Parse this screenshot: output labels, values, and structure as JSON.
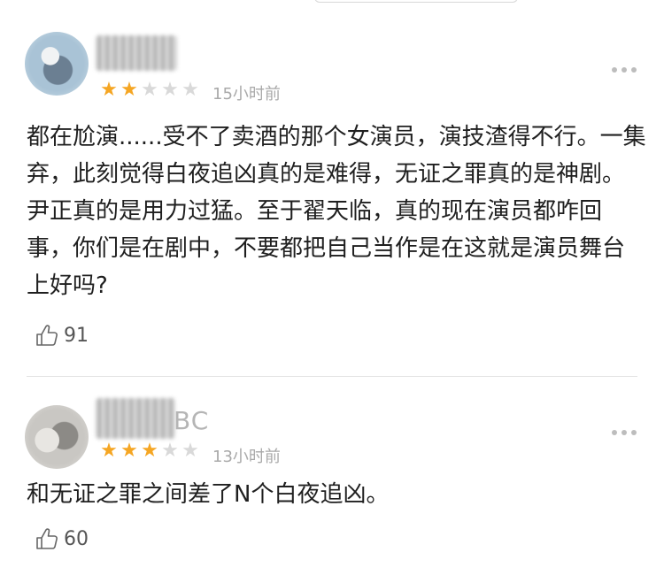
{
  "reviews": [
    {
      "username_suffix": "",
      "rating": 2,
      "max_rating": 5,
      "time": "15小时前",
      "body": "都在尬演......受不了卖酒的那个女演员，演技渣得不行。一集弃，此刻觉得白夜追凶真的是难得，无证之罪真的是神剧。尹正真的是用力过猛。至于翟天临，真的现在演员都咋回事，你们是在剧中，不要都把自己当作是在这就是演员舞台上好吗?",
      "likes": "91"
    },
    {
      "username_suffix": "BC",
      "rating": 3,
      "max_rating": 5,
      "time": "13小时前",
      "body": "和无证之罪之间差了N个白夜追凶。",
      "likes": "60"
    }
  ],
  "colors": {
    "star_on": "#f5a623",
    "star_off": "#d9d9d9",
    "muted_text": "#a9a9a9"
  },
  "icons": {
    "like": "thumbs-up-icon",
    "more": "more-dots-icon",
    "star": "star-icon"
  }
}
